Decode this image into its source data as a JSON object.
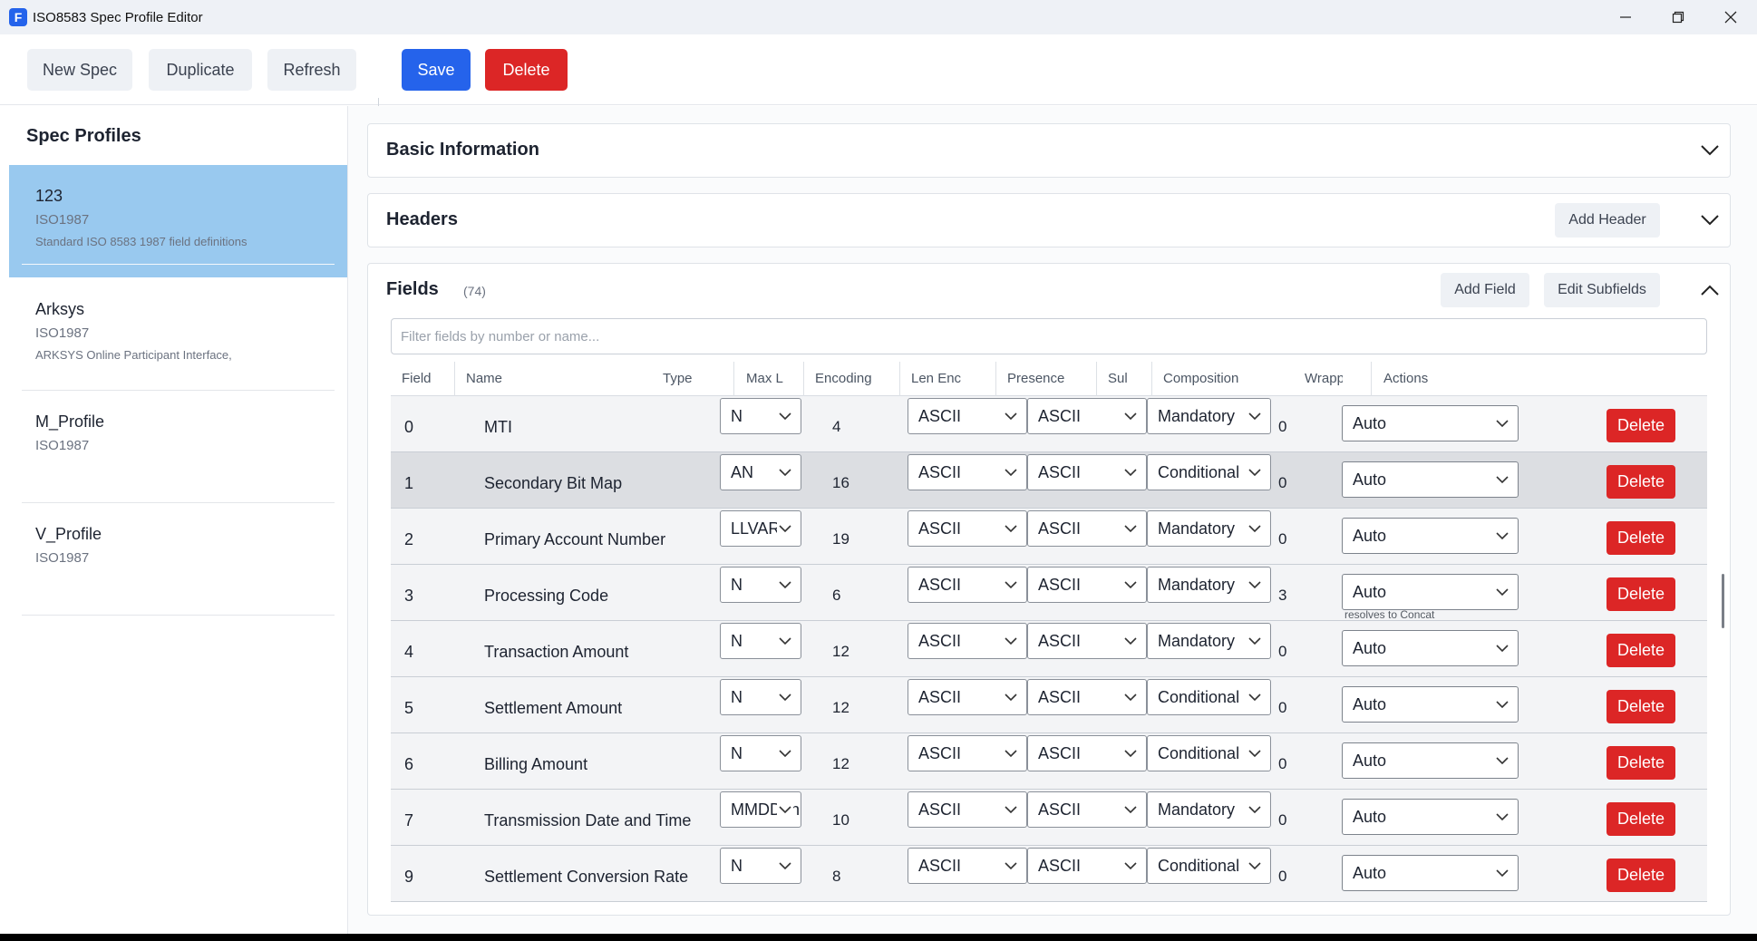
{
  "window": {
    "title": "ISO8583 Spec Profile Editor",
    "icon_letter": "F"
  },
  "toolbar": {
    "new_spec": "New Spec",
    "duplicate": "Duplicate",
    "refresh": "Refresh",
    "save": "Save",
    "delete": "Delete"
  },
  "sidebar": {
    "title": "Spec Profiles",
    "profiles": [
      {
        "name": "123",
        "standard": "ISO1987",
        "description": "Standard ISO 8583 1987 field definitions",
        "selected": true
      },
      {
        "name": "Arksys",
        "standard": "ISO1987",
        "description": "ARKSYS Online Participant Interface,"
      },
      {
        "name": "M_Profile",
        "standard": "ISO1987",
        "description": ""
      },
      {
        "name": "V_Profile",
        "standard": "ISO1987",
        "description": ""
      }
    ]
  },
  "sections": {
    "basic": {
      "title": "Basic Information"
    },
    "headers": {
      "title": "Headers",
      "add_button": "Add Header"
    },
    "fields": {
      "title": "Fields",
      "count": "(74)",
      "add_button": "Add Field",
      "edit_subfields_button": "Edit Subfields",
      "filter_placeholder": "Filter fields by number or name..."
    }
  },
  "table": {
    "headers": [
      "Field",
      "Name",
      "Type",
      "Max L",
      "Encoding",
      "Len Enc",
      "Presence",
      "Sul",
      "Composition",
      "Wrappe",
      "Actions"
    ],
    "delete_label": "Delete",
    "rows": [
      {
        "field": "0",
        "name": "MTI",
        "type": "N",
        "max": "4",
        "encoding": "ASCII",
        "len_enc": "ASCII",
        "presence": "Mandatory",
        "sub": "0",
        "composition": "Auto",
        "note": ""
      },
      {
        "field": "1",
        "name": "Secondary Bit Map",
        "type": "AN",
        "max": "16",
        "encoding": "ASCII",
        "len_enc": "ASCII",
        "presence": "Conditional",
        "sub": "0",
        "composition": "Auto",
        "note": ""
      },
      {
        "field": "2",
        "name": "Primary Account Number",
        "type": "LLVAR",
        "max": "19",
        "encoding": "ASCII",
        "len_enc": "ASCII",
        "presence": "Mandatory",
        "sub": "0",
        "composition": "Auto",
        "note": ""
      },
      {
        "field": "3",
        "name": "Processing Code",
        "type": "N",
        "max": "6",
        "encoding": "ASCII",
        "len_enc": "ASCII",
        "presence": "Mandatory",
        "sub": "3",
        "composition": "Auto",
        "note": "resolves to Concat"
      },
      {
        "field": "4",
        "name": "Transaction Amount",
        "type": "N",
        "max": "12",
        "encoding": "ASCII",
        "len_enc": "ASCII",
        "presence": "Mandatory",
        "sub": "0",
        "composition": "Auto",
        "note": ""
      },
      {
        "field": "5",
        "name": "Settlement Amount",
        "type": "N",
        "max": "12",
        "encoding": "ASCII",
        "len_enc": "ASCII",
        "presence": "Conditional",
        "sub": "0",
        "composition": "Auto",
        "note": ""
      },
      {
        "field": "6",
        "name": "Billing Amount",
        "type": "N",
        "max": "12",
        "encoding": "ASCII",
        "len_enc": "ASCII",
        "presence": "Conditional",
        "sub": "0",
        "composition": "Auto",
        "note": ""
      },
      {
        "field": "7",
        "name": "Transmission Date and Time",
        "type": "MMDDhhmmss",
        "max": "10",
        "encoding": "ASCII",
        "len_enc": "ASCII",
        "presence": "Mandatory",
        "sub": "0",
        "composition": "Auto",
        "note": ""
      },
      {
        "field": "9",
        "name": "Settlement Conversion Rate",
        "type": "N",
        "max": "8",
        "encoding": "ASCII",
        "len_enc": "ASCII",
        "presence": "Conditional",
        "sub": "0",
        "composition": "Auto",
        "note": ""
      }
    ]
  },
  "colors": {
    "accent_blue": "#2563eb",
    "danger_red": "#dc2626",
    "selected_profile": "#99c9ef"
  }
}
